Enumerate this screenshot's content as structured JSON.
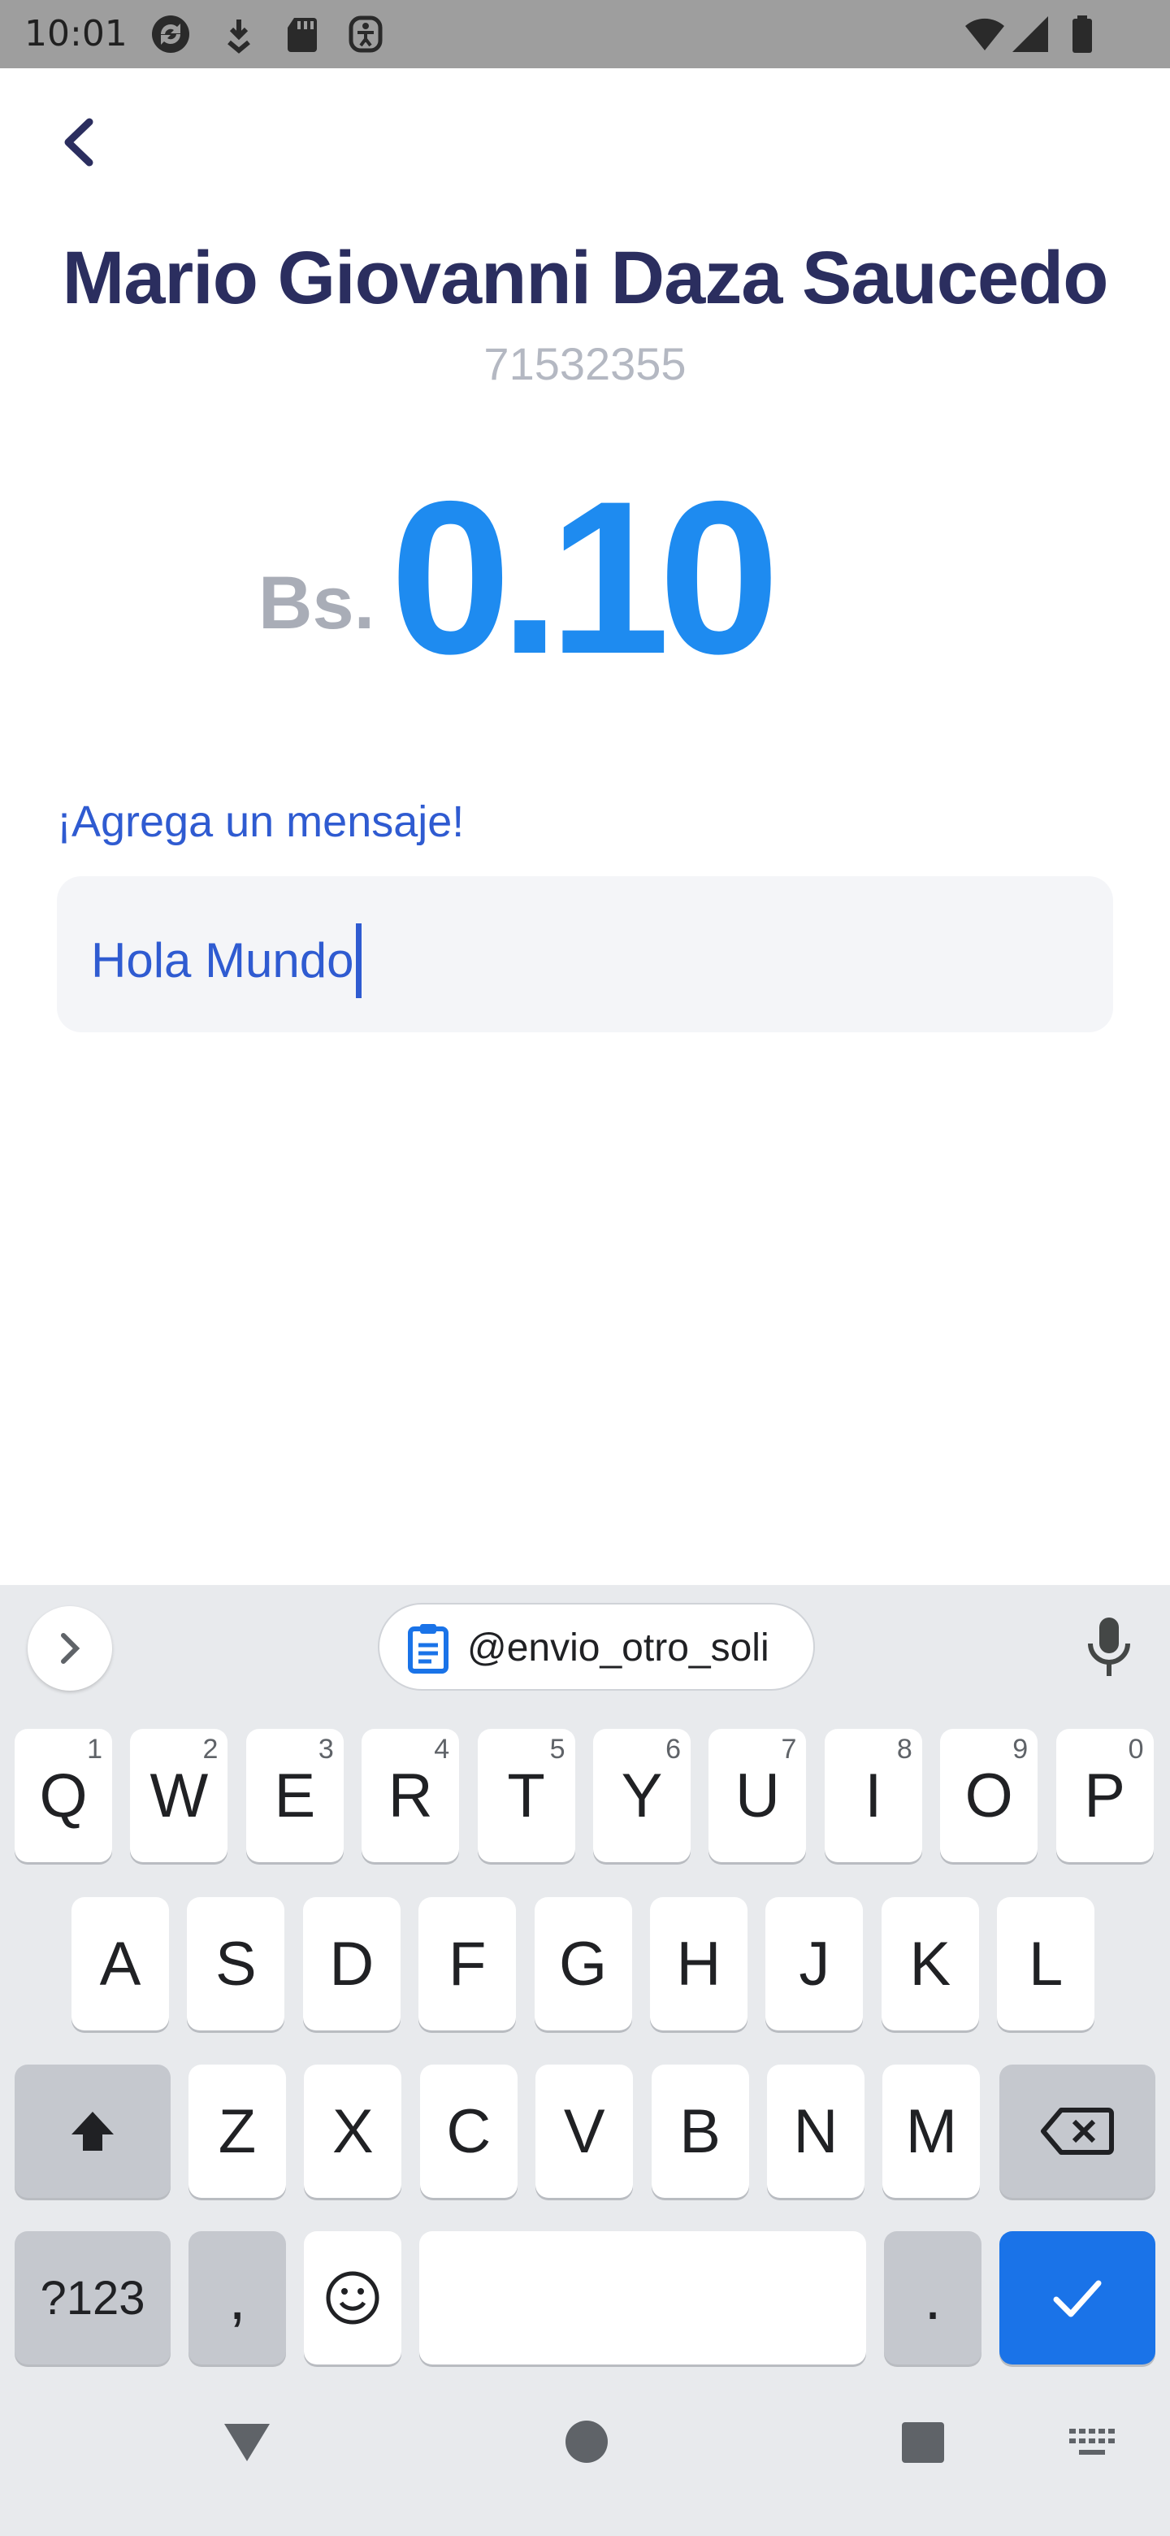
{
  "status_bar": {
    "time": "10:01",
    "left_icons": [
      "sync-icon",
      "download-icon",
      "sd-card-icon",
      "accessibility-icon"
    ],
    "right_icons": [
      "wifi-icon",
      "cellular-signal-icon",
      "battery-icon"
    ]
  },
  "header": {
    "back_icon": "chevron-left-icon"
  },
  "recipient": {
    "name": "Mario Giovanni Daza Saucedo",
    "phone": "71532355"
  },
  "amount": {
    "currency": "Bs.",
    "value": "0.10"
  },
  "message": {
    "label": "¡Agrega un mensaje!",
    "value": "Hola Mundo"
  },
  "keyboard": {
    "clipboard_suggestion": "@envio_otro_soli",
    "row1": [
      {
        "label": "Q",
        "hint": "1"
      },
      {
        "label": "W",
        "hint": "2"
      },
      {
        "label": "E",
        "hint": "3"
      },
      {
        "label": "R",
        "hint": "4"
      },
      {
        "label": "T",
        "hint": "5"
      },
      {
        "label": "Y",
        "hint": "6"
      },
      {
        "label": "U",
        "hint": "7"
      },
      {
        "label": "I",
        "hint": "8"
      },
      {
        "label": "O",
        "hint": "9"
      },
      {
        "label": "P",
        "hint": "0"
      }
    ],
    "row2": [
      "A",
      "S",
      "D",
      "F",
      "G",
      "H",
      "J",
      "K",
      "L"
    ],
    "row3": [
      "Z",
      "X",
      "C",
      "V",
      "B",
      "N",
      "M"
    ],
    "symbols_label": "?123",
    "comma_label": ",",
    "period_label": ".",
    "colors": {
      "background": "#e8eaed",
      "key": "#ffffff",
      "dark_key": "#c5c8ce",
      "action_key": "#1a73e8"
    }
  },
  "colors": {
    "name": "#2b2e5f",
    "amount": "#1e8bf0",
    "accent_text": "#2f5bd1",
    "muted": "#b4b8c2"
  }
}
